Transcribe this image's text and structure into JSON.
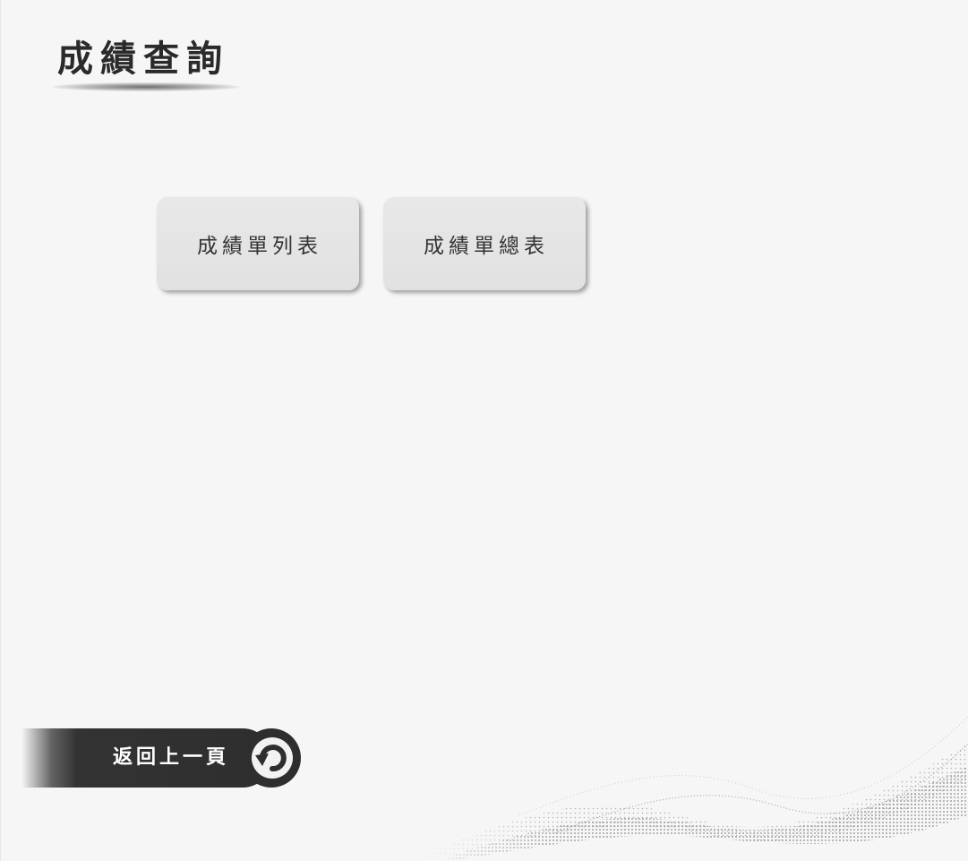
{
  "page": {
    "title": "成績查詢"
  },
  "menu": {
    "items": [
      {
        "label": "成績單列表"
      },
      {
        "label": "成績單總表"
      }
    ]
  },
  "back_button": {
    "label": "返回上一頁",
    "icon": "undo-arrow-icon"
  },
  "colors": {
    "background": "#f6f6f6",
    "button_fill": "#e3e3e3",
    "back_bar": "#2e2e2e",
    "title_text": "#2a2a2a"
  }
}
